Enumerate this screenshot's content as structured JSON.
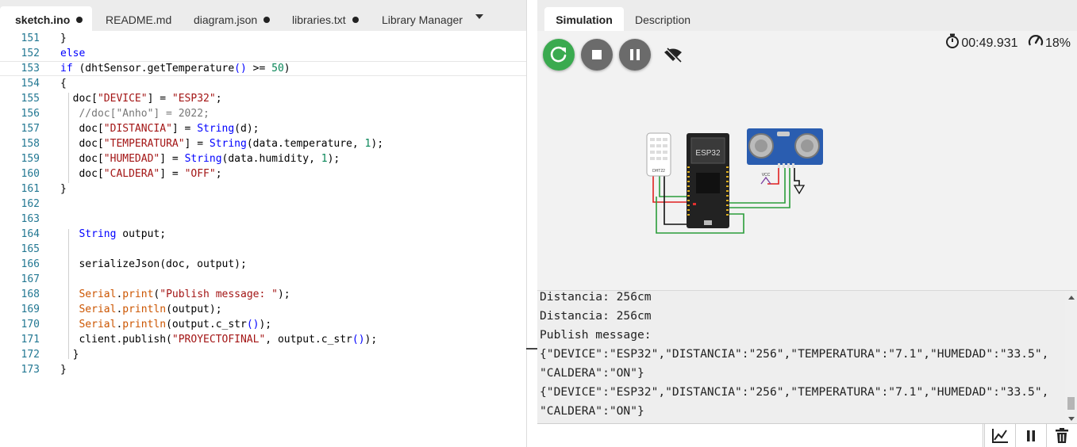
{
  "editor": {
    "tabs": [
      {
        "label": "sketch.ino",
        "modified": true
      },
      {
        "label": "README.md",
        "modified": false
      },
      {
        "label": "diagram.json",
        "modified": true
      },
      {
        "label": "libraries.txt",
        "modified": true
      },
      {
        "label": "Library Manager",
        "modified": false
      }
    ],
    "lines": [
      {
        "num": "151",
        "html": "}"
      },
      {
        "num": "152",
        "html": "<span class=\"kw\">else</span>"
      },
      {
        "num": "153",
        "html": "<span class=\"kw\">if</span> (dhtSensor.getTemperature<span class=\"kw\">()</span> &gt;= <span class=\"num\">50</span>)"
      },
      {
        "num": "154",
        "html": "{"
      },
      {
        "num": "155",
        "html": "  doc[<span class=\"str\">\"DEVICE\"</span>] = <span class=\"str\">\"ESP32\"</span>;"
      },
      {
        "num": "156",
        "html": "   <span class=\"cmt\">//doc[\"Anho\"] = 2022;</span>"
      },
      {
        "num": "157",
        "html": "   doc[<span class=\"str\">\"DISTANCIA\"</span>] = <span class=\"kw\">String</span>(d);"
      },
      {
        "num": "158",
        "html": "   doc[<span class=\"str\">\"TEMPERATURA\"</span>] = <span class=\"kw\">String</span>(data.temperature, <span class=\"num\">1</span>);"
      },
      {
        "num": "159",
        "html": "   doc[<span class=\"str\">\"HUMEDAD\"</span>] = <span class=\"kw\">String</span>(data.humidity, <span class=\"num\">1</span>);"
      },
      {
        "num": "160",
        "html": "   doc[<span class=\"str\">\"CALDERA\"</span>] = <span class=\"str\">\"OFF\"</span>;"
      },
      {
        "num": "161",
        "html": "}"
      },
      {
        "num": "162",
        "html": ""
      },
      {
        "num": "163",
        "html": ""
      },
      {
        "num": "164",
        "html": "   <span class=\"kw\">String</span> output;"
      },
      {
        "num": "165",
        "html": ""
      },
      {
        "num": "166",
        "html": "   serializeJson(doc, output);"
      },
      {
        "num": "167",
        "html": ""
      },
      {
        "num": "168",
        "html": "   <span class=\"cls\">Serial</span>.<span class=\"cls\">print</span>(<span class=\"str\">\"Publish message: \"</span>);"
      },
      {
        "num": "169",
        "html": "   <span class=\"cls\">Serial</span>.<span class=\"cls\">println</span>(output);"
      },
      {
        "num": "170",
        "html": "   <span class=\"cls\">Serial</span>.<span class=\"cls\">println</span>(output.c_str<span class=\"kw\">()</span>);"
      },
      {
        "num": "171",
        "html": "   client.publish(<span class=\"str\">\"PROYECTOFINAL\"</span>, output.c_str<span class=\"kw\">()</span>);"
      },
      {
        "num": "172",
        "html": "  }"
      },
      {
        "num": "173",
        "html": "}"
      }
    ]
  },
  "simulation": {
    "tabs": [
      "Simulation",
      "Description"
    ],
    "timer": "00:49.931",
    "speed": "18%",
    "colors": {
      "restart": "#3aaa4f",
      "control": "#6b6b6b"
    },
    "icons": [
      "restart-icon",
      "stop-icon",
      "pause-icon",
      "wifi-off-icon",
      "stopwatch-icon",
      "speedometer-icon"
    ],
    "parts": {
      "sensor": "DHT22",
      "board": "ESP32",
      "supply": "VCC"
    }
  },
  "serial": {
    "lines": [
      "Distancia: 256cm",
      "Distancia: 256cm",
      "Publish message:",
      "{\"DEVICE\":\"ESP32\",\"DISTANCIA\":\"256\",\"TEMPERATURA\":\"7.1\",\"HUMEDAD\":\"33.5\",",
      "\"CALDERA\":\"ON\"}",
      "{\"DEVICE\":\"ESP32\",\"DISTANCIA\":\"256\",\"TEMPERATURA\":\"7.1\",\"HUMEDAD\":\"33.5\",",
      "\"CALDERA\":\"ON\"}"
    ],
    "input_value": "",
    "buttons": [
      "chart-icon",
      "pause-icon",
      "trash-icon"
    ]
  }
}
